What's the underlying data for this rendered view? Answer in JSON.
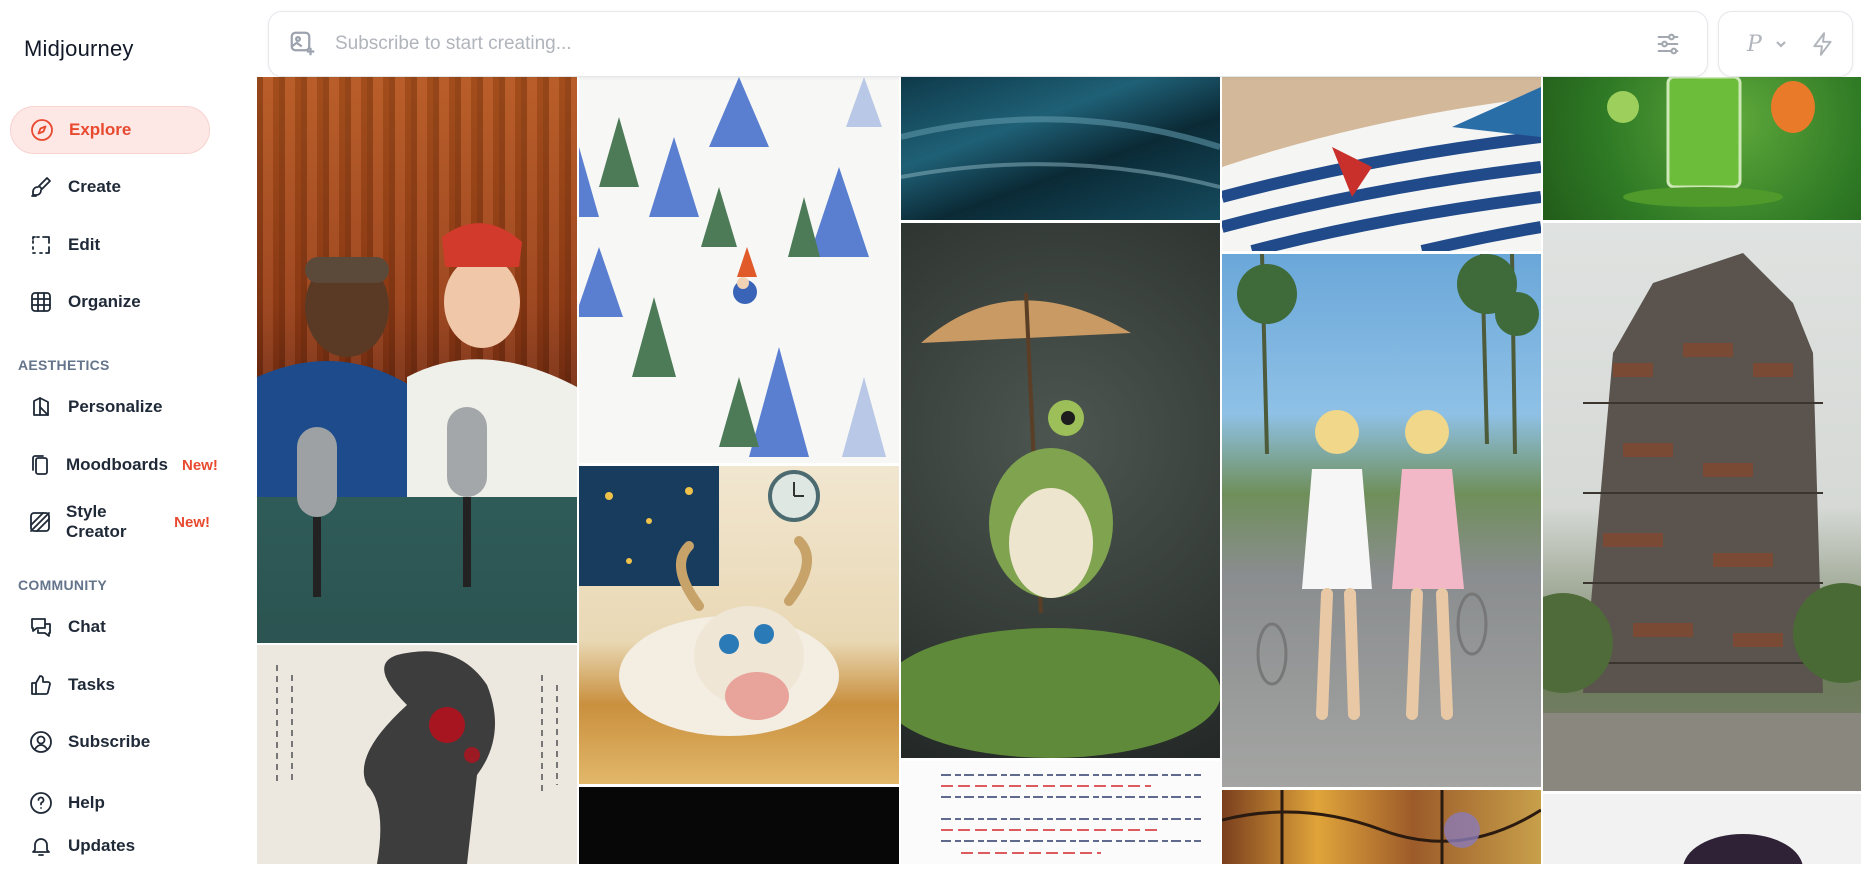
{
  "app": {
    "brand": "Midjourney"
  },
  "sidebar": {
    "main_items": [
      {
        "label": "Explore",
        "icon": "compass-icon",
        "active": true
      },
      {
        "label": "Create",
        "icon": "brush-icon"
      },
      {
        "label": "Edit",
        "icon": "edit-icon"
      },
      {
        "label": "Organize",
        "icon": "grid-icon"
      }
    ],
    "aesthetics_label": "AESTHETICS",
    "aesthetics_items": [
      {
        "label": "Personalize",
        "icon": "personalize-icon"
      },
      {
        "label": "Moodboards",
        "icon": "moodboard-icon",
        "badge": "New!"
      },
      {
        "label": "Style Creator",
        "icon": "style-creator-icon",
        "badge": "New!"
      }
    ],
    "community_label": "COMMUNITY",
    "community_items": [
      {
        "label": "Chat",
        "icon": "chat-icon"
      },
      {
        "label": "Tasks",
        "icon": "thumbs-up-icon"
      },
      {
        "label": "Subscribe",
        "icon": "user-circle-icon"
      }
    ],
    "footer_items": [
      {
        "label": "Help",
        "icon": "help-icon"
      },
      {
        "label": "Updates",
        "icon": "bell-icon"
      }
    ]
  },
  "prompt_bar": {
    "placeholder": "Subscribe to start creating...",
    "add_image_icon": "image-add-icon",
    "settings_icon": "sliders-icon"
  },
  "mode": {
    "label": "P",
    "chevron_icon": "chevron-down-icon",
    "speed_icon": "lightning-icon"
  },
  "accent_color": "#e8492f",
  "gallery": {
    "images": [
      "podcast-hosts",
      "winter-gnome-pattern",
      "ocean-wave",
      "striped-shirt",
      "green-juice",
      "frog-umbrella",
      "sleepy-goat",
      "tennis-twins",
      "brutalist-tower",
      "ink-portrait",
      "dark-scene",
      "handwritten-notes",
      "stained-glass",
      "purple-object"
    ]
  }
}
